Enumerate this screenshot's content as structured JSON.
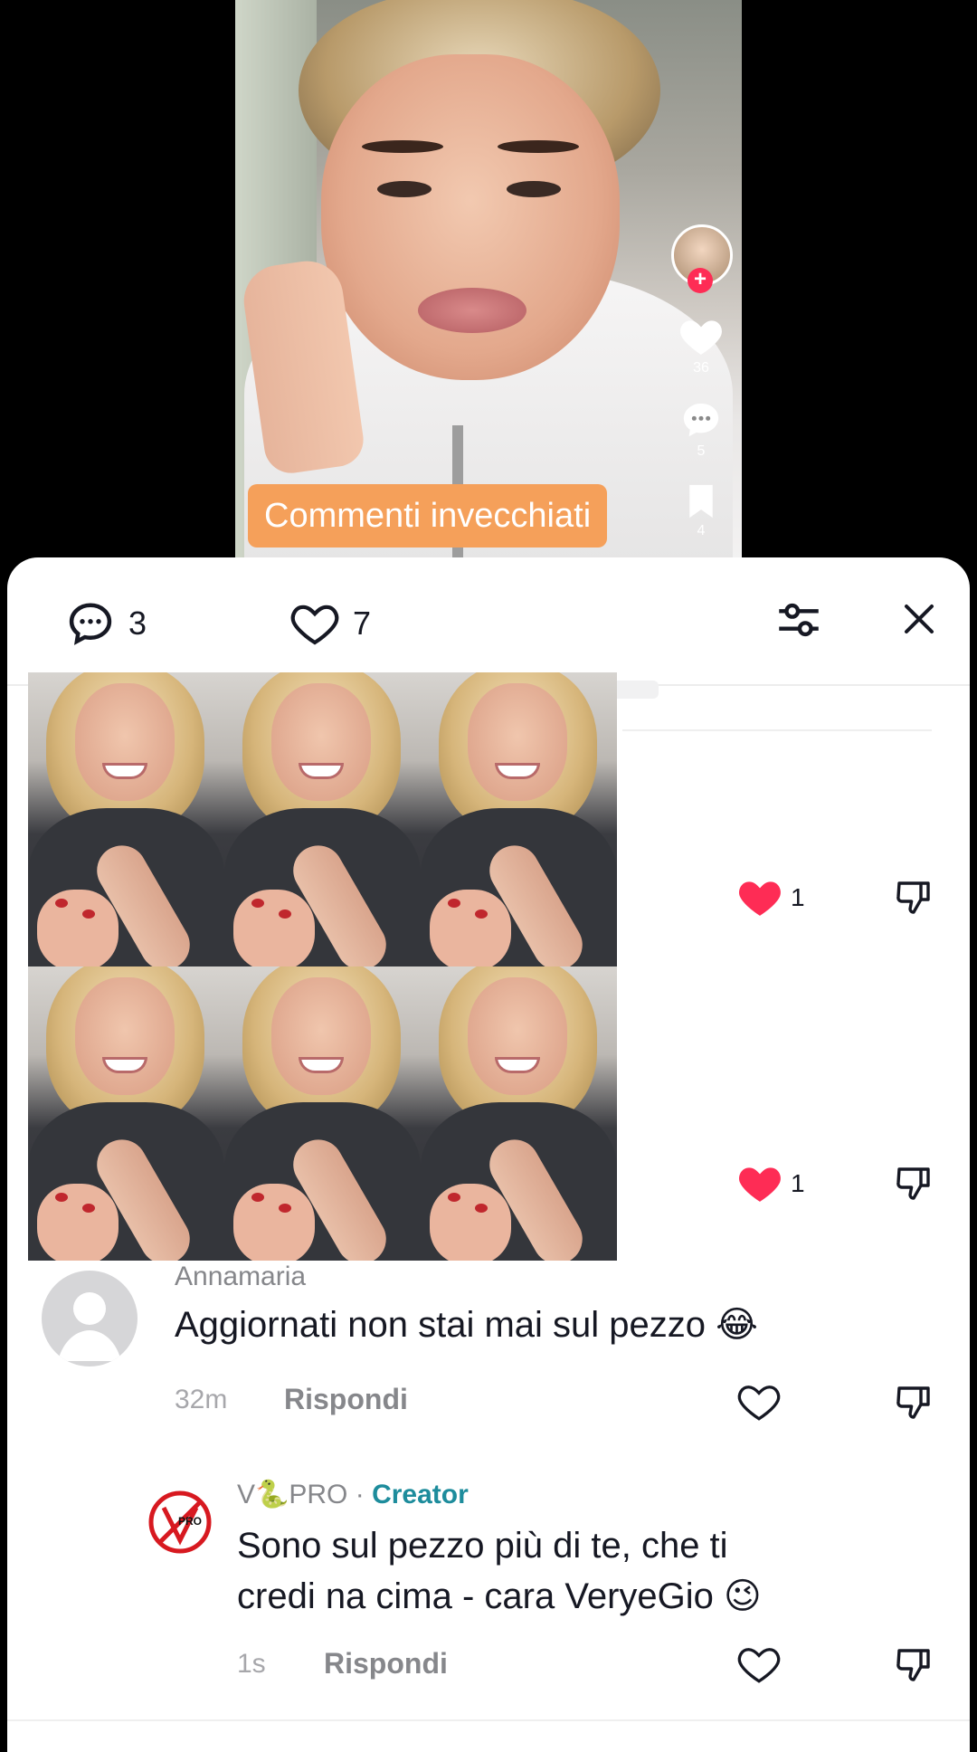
{
  "video": {
    "side": {
      "likes": "36",
      "comments": "5",
      "saves": "4"
    },
    "overlay_label": "Commenti invecchiati"
  },
  "sheet": {
    "header": {
      "comments_count": "3",
      "likes_count": "7"
    },
    "stub_comments": [
      {
        "like_count": "1"
      },
      {
        "like_count": "1"
      }
    ],
    "comments": [
      {
        "username": "Annamaria",
        "text": "Aggiornati non stai mai sul pezzo 😂",
        "time": "32m",
        "reply_label": "Rispondi"
      },
      {
        "username": "V🐍PRO",
        "separator": "·",
        "badge": "Creator",
        "text_line1": "Sono sul pezzo più di te, che ti",
        "text_line2": "credi na cima - cara VeryeGio 😉",
        "time": "1s",
        "reply_label": "Rispondi",
        "avatar_text": "PRO"
      }
    ]
  },
  "colors": {
    "accent_red": "#fe2c55",
    "creator_teal": "#1d8c9c",
    "overlay_orange": "#f5a05a"
  },
  "icons": [
    "chat-bubble-icon",
    "heart-outline-icon",
    "filter-sliders-icon",
    "close-icon",
    "dislike-icon",
    "heart-filled-icon",
    "bookmark-icon",
    "plus-icon"
  ]
}
